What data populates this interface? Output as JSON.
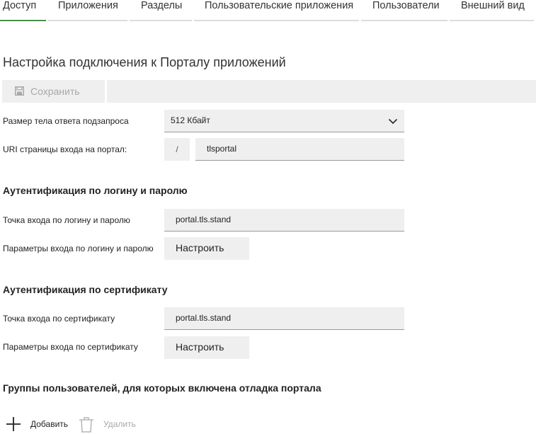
{
  "tabs": [
    {
      "label": "Доступ",
      "active": true
    },
    {
      "label": "Приложения",
      "active": false
    },
    {
      "label": "Разделы",
      "active": false
    },
    {
      "label": "Пользовательские приложения",
      "active": false
    },
    {
      "label": "Пользователи",
      "active": false
    },
    {
      "label": "Внешний вид",
      "active": false
    }
  ],
  "page_title": "Настройка подключения к Порталу приложений",
  "toolbar": {
    "save_label": "Сохранить",
    "save_icon": "floppy-disk-icon"
  },
  "general": {
    "response_size": {
      "label": "Размер тела ответа подзапроса",
      "value": "512 Кбайт"
    },
    "portal_uri": {
      "label": "URI страницы входа на портал:",
      "prefix": "/",
      "value": "tlsportal"
    }
  },
  "login_auth": {
    "heading": "Аутентификация по логину и паролю",
    "entry_point": {
      "label": "Точка входа по логину и паролю",
      "value": "portal.tls.stand"
    },
    "params": {
      "label": "Параметры входа по логину и паролю",
      "button": "Настроить"
    }
  },
  "cert_auth": {
    "heading": "Аутентификация по сертификату",
    "entry_point": {
      "label": "Точка входа по сертификату",
      "value": "portal.tls.stand"
    },
    "params": {
      "label": "Параметры входа по сертификату",
      "button": "Настроить"
    }
  },
  "debug_groups": {
    "heading": "Группы пользователей, для которых включена отладка портала",
    "add_label": "Добавить",
    "delete_label": "Удалить"
  },
  "colors": {
    "active_tab": "#3c9b3c",
    "field_bg": "#efefef",
    "disabled_text": "#a8a8a8"
  }
}
